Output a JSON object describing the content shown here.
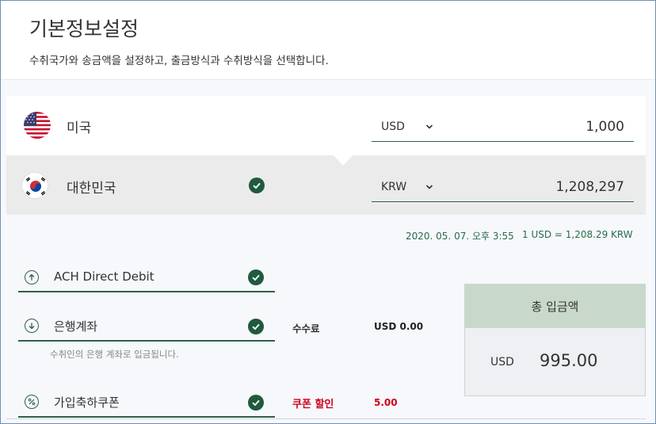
{
  "header": {
    "title": "기본정보설정",
    "subtitle": "수취국가와 송금액을 설정하고, 출금방식과 수취방식을 선택합니다."
  },
  "send": {
    "country": "미국",
    "flag_icon": "us-flag-icon",
    "currency": "USD",
    "amount": "1,000"
  },
  "receive": {
    "country": "대한민국",
    "flag_icon": "kr-flag-icon",
    "currency": "KRW",
    "amount": "1,208,297"
  },
  "rate": {
    "timestamp": "2020. 05. 07. 오후 3:55",
    "text": "1 USD = 1,208.29 KRW"
  },
  "withdraw": {
    "label": "ACH Direct Debit",
    "icon": "arrow-up-circle-icon"
  },
  "deposit": {
    "label": "은행계좌",
    "icon": "arrow-down-circle-icon",
    "note": "수취인의 은행 계좌로 입금됩니다."
  },
  "coupon": {
    "label": "가입축하쿠폰",
    "icon": "percent-circle-icon"
  },
  "fees": {
    "fee_label": "수수료",
    "fee_value": "USD 0.00",
    "coupon_label": "쿠폰 할인",
    "coupon_value": "5.00"
  },
  "total": {
    "title": "총 입금액",
    "currency": "USD",
    "amount": "995.00"
  },
  "colors": {
    "accent": "#1f5a3e",
    "discount": "#d0021b",
    "total_header": "#c8d9cc"
  }
}
